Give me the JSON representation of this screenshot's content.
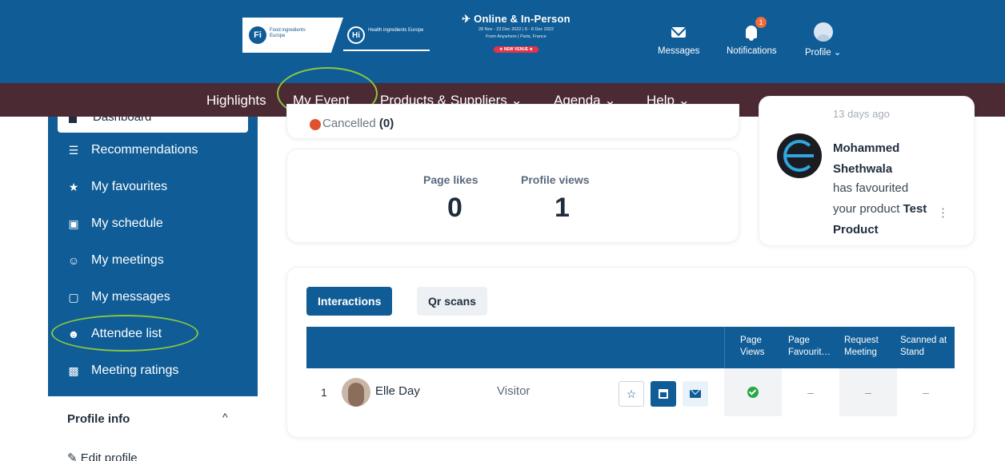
{
  "header": {
    "logos": {
      "fi_badge": "Fi",
      "fi_text": "Food ingredients Europe",
      "hi_badge": "Hi",
      "hi_text": "Health ingredients Europe"
    },
    "event_mode": "Online & In-Person",
    "event_dates": "28 Nov - 23 Dec 2022 | 6 - 8 Dec 2022",
    "event_places": "From Anywhere | Paris, France",
    "new_venue": "★ NEW VENUE ★",
    "messages_label": "Messages",
    "notifications_label": "Notifications",
    "notifications_count": "1",
    "profile_label": "Profile ⌄"
  },
  "nav": {
    "items": [
      {
        "label": "Highlights"
      },
      {
        "label": "My Event"
      },
      {
        "label": "Products & Suppliers ⌄"
      },
      {
        "label": "Agenda ⌄"
      },
      {
        "label": "Help ⌄"
      }
    ]
  },
  "sidebar": {
    "top_item": "Dashboard",
    "items": [
      {
        "label": "Recommendations",
        "icon": "list-icon"
      },
      {
        "label": "My favourites",
        "icon": "star-icon"
      },
      {
        "label": "My schedule",
        "icon": "calendar-icon"
      },
      {
        "label": "My meetings",
        "icon": "group-icon"
      },
      {
        "label": "My messages",
        "icon": "chat-icon"
      },
      {
        "label": "Attendee list",
        "icon": "people-icon"
      },
      {
        "label": "Meeting ratings",
        "icon": "chart-icon"
      }
    ],
    "profile_info_title": "Profile info",
    "profile_info_chevron": "^",
    "edit_profile": "Edit profile"
  },
  "cancelled": {
    "label": "Cancelled",
    "count": "(0)"
  },
  "stats": {
    "page_likes_label": "Page likes",
    "page_likes_value": "0",
    "profile_views_label": "Profile views",
    "profile_views_value": "1"
  },
  "activity": {
    "time": "13 days ago",
    "name": "Mohammed Shethwala",
    "description": "has favourited your product",
    "product": "Test Product"
  },
  "interactions": {
    "tabs": [
      {
        "label": "Interactions",
        "active": true
      },
      {
        "label": "Qr scans",
        "active": false
      }
    ],
    "columns": [
      "Page Views",
      "Page Favourit…",
      "Request Meeting",
      "Scanned at Stand"
    ],
    "rows": [
      {
        "index": "1",
        "name": "Elle Day",
        "role": "Visitor",
        "page_views": "check",
        "page_favourited": "–",
        "request_meeting": "–",
        "scanned_at_stand": "–"
      }
    ]
  },
  "colors": {
    "brand_blue": "#0f5c96",
    "nav_maroon": "#4b2a33",
    "annotation_green": "#8bc53f",
    "cancel_red": "#e0512f",
    "success_green": "#28a745"
  }
}
